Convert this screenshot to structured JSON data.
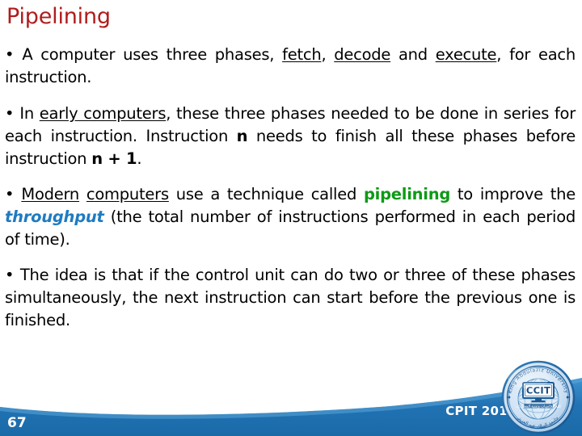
{
  "slide": {
    "title": "Pipelining",
    "title_color": "#b01c1c",
    "background_color": "#ffffff",
    "page_number": "67",
    "course_code": "CPIT 201",
    "accent_blue": "#1f7bc0",
    "accent_green": "#0d9a16",
    "band_color_dark": "#1567ab",
    "band_color_light": "#4a9cd6"
  },
  "bullets": {
    "b1": {
      "marker": "•",
      "part1": " A computer uses three phases, ",
      "term1": "fetch",
      "part2": ", ",
      "term2": "decode",
      "part3": " and ",
      "term3": "execute",
      "part4": ", for each instruction."
    },
    "b2": {
      "marker": "•",
      "part1": " In ",
      "term1": "early computers",
      "part2": ", these three phases needed to be done in series for each instruction. Instruction ",
      "var1": "n",
      "part3": " needs to finish all these phases before instruction ",
      "var2": "n + 1",
      "part4": "."
    },
    "b3": {
      "marker": "•",
      "part1": " ",
      "term1": "Modern",
      "part2": " ",
      "term2": "computers",
      "part3": " use a technique called ",
      "highlight_green": "pipelining",
      "part4": " to improve the ",
      "highlight_blue": "throughput",
      "part5": " (the total number of instructions performed in each period of time)."
    },
    "b4": {
      "marker": "•",
      "text": " The idea is that if the control unit can do two or three of these phases simultaneously, the next instruction can start before the previous one is finished."
    }
  },
  "logo": {
    "name": "ccit-king-abdulaziz-university-logo",
    "center_text": "CCIT",
    "outer_text_top": "King Abdulaziz University",
    "outer_text_arabic": "جامعة الملك عبد العزيز"
  }
}
